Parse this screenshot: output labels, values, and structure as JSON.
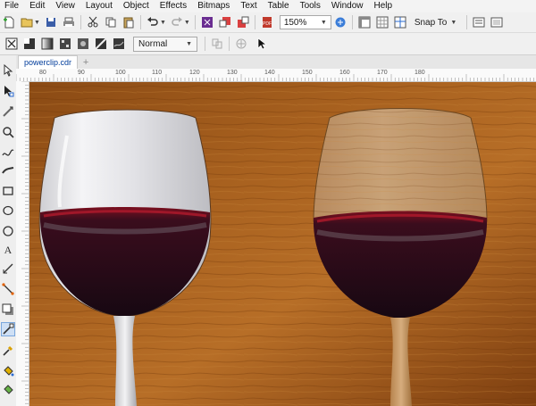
{
  "menu": [
    "File",
    "Edit",
    "View",
    "Layout",
    "Object",
    "Effects",
    "Bitmaps",
    "Text",
    "Table",
    "Tools",
    "Window",
    "Help"
  ],
  "toolbar": {
    "zoom_value": "150%",
    "snap_label": "Snap To"
  },
  "property_bar": {
    "merge_mode": "Normal"
  },
  "document": {
    "tab_label": "powerclip.cdr"
  },
  "ruler": {
    "labels": [
      "80",
      "90",
      "100",
      "110",
      "120",
      "130",
      "140",
      "150",
      "160",
      "170",
      "180"
    ]
  },
  "colors": {
    "wood": "#9a5a1f",
    "wine": "#2a0a14",
    "accent": "#6a2d91"
  }
}
